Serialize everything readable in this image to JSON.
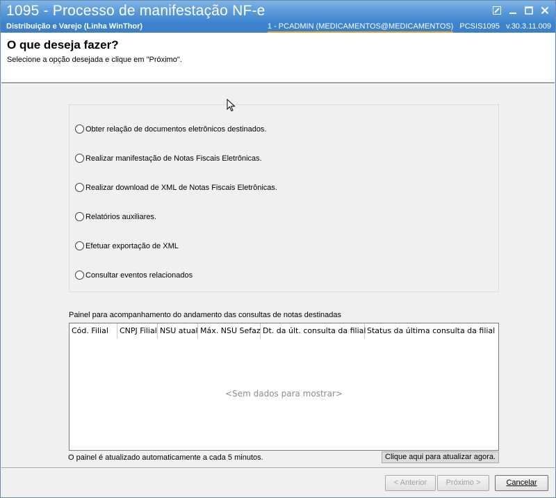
{
  "window": {
    "title": "1095 - Processo de manifestação NF-e",
    "subtitle": "Distribuição e Varejo (Linha WinThor)",
    "user_info": "1 - PCADMIN (MEDICAMENTOS@MEDICAMENTOS)",
    "routine": "PCSIS1095",
    "version": "v.30.3.11.009",
    "controls": [
      "edit-icon",
      "minimize-icon",
      "maximize-icon",
      "close-icon"
    ]
  },
  "header": {
    "title": "O que deseja fazer?",
    "description": "Selecione a opção desejada e clique em \"Próximo\"."
  },
  "options": [
    {
      "label": "Obter relação de documentos eletrônicos destinados.",
      "selected": false
    },
    {
      "label": "Realizar manifestação de Notas Fiscais Eletrônicas.",
      "selected": false
    },
    {
      "label": "Realizar download de XML de Notas Fiscais Eletrônicas.",
      "selected": false
    },
    {
      "label": "Relatórios auxiliares.",
      "selected": false
    },
    {
      "label": "Efetuar exportação de XML",
      "selected": false
    },
    {
      "label": "Consultar eventos relacionados",
      "selected": false
    }
  ],
  "panel": {
    "label": "Painel para acompanhamento do andamento das consultas de notas destinadas",
    "columns": [
      "Cód. Filial",
      "CNPJ Filial",
      "NSU atual",
      "Máx. NSU Sefaz",
      "Dt. da últ. consulta da filial",
      "Status da última consulta da filial"
    ],
    "empty_text": "<Sem dados para mostrar>",
    "note": "O painel é atualizado automaticamente a cada 5 minutos.",
    "refresh_label": "Clique aqui para atualizar agora."
  },
  "footer": {
    "back_label": "< Anterior",
    "next_label": "Próximo >",
    "cancel_label": "Cancelar"
  }
}
